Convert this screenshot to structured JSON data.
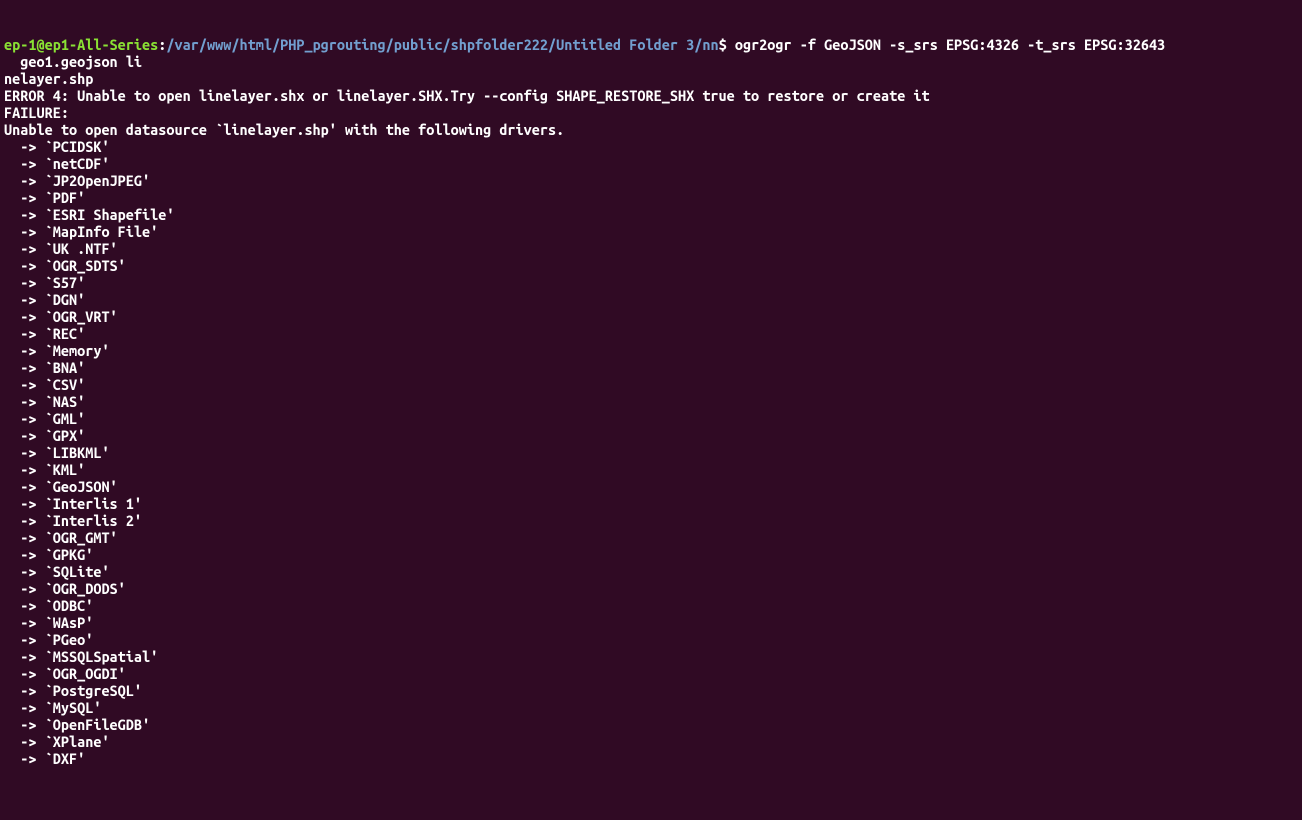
{
  "prompt": {
    "user": "ep-1@ep1-All-Series",
    "colon": ":",
    "path": "/var/www/html/PHP_pgrouting/public/shpfolder222/Untitled Folder 3/nn",
    "dollar": "$",
    "command_line1": " ogr2ogr -f GeoJSON -s_srs EPSG:4326 -t_srs EPSG:32643 ",
    "command_line2": "  geo1.geojson li",
    "command_line3": "nelayer.shp"
  },
  "error_line": "ERROR 4: Unable to open linelayer.shx or linelayer.SHX.Try --config SHAPE_RESTORE_SHX true to restore or create it",
  "failure_line": "FAILURE:",
  "unable_line": "Unable to open datasource `linelayer.shp' with the following drivers.",
  "drivers": [
    "  -> `PCIDSK'",
    "  -> `netCDF'",
    "  -> `JP2OpenJPEG'",
    "  -> `PDF'",
    "  -> `ESRI Shapefile'",
    "  -> `MapInfo File'",
    "  -> `UK .NTF'",
    "  -> `OGR_SDTS'",
    "  -> `S57'",
    "  -> `DGN'",
    "  -> `OGR_VRT'",
    "  -> `REC'",
    "  -> `Memory'",
    "  -> `BNA'",
    "  -> `CSV'",
    "  -> `NAS'",
    "  -> `GML'",
    "  -> `GPX'",
    "  -> `LIBKML'",
    "  -> `KML'",
    "  -> `GeoJSON'",
    "  -> `Interlis 1'",
    "  -> `Interlis 2'",
    "  -> `OGR_GMT'",
    "  -> `GPKG'",
    "  -> `SQLite'",
    "  -> `OGR_DODS'",
    "  -> `ODBC'",
    "  -> `WAsP'",
    "  -> `PGeo'",
    "  -> `MSSQLSpatial'",
    "  -> `OGR_OGDI'",
    "  -> `PostgreSQL'",
    "  -> `MySQL'",
    "  -> `OpenFileGDB'",
    "  -> `XPlane'",
    "  -> `DXF'"
  ]
}
